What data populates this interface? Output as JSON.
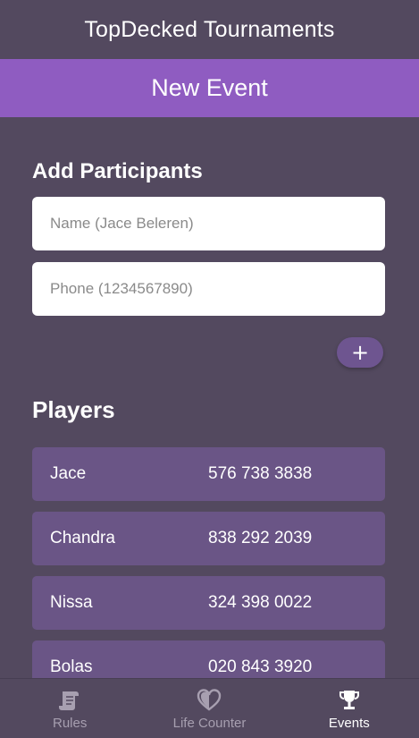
{
  "app": {
    "title": "TopDecked Tournaments"
  },
  "page": {
    "title": "New Event"
  },
  "add_participants": {
    "title": "Add Participants",
    "name_placeholder": "Name (Jace Beleren)",
    "phone_placeholder": "Phone (1234567890)",
    "add_button_label": "+"
  },
  "players": {
    "title": "Players",
    "rows": [
      {
        "name": "Jace",
        "phone": "576 738 3838"
      },
      {
        "name": "Chandra",
        "phone": "838 292 2039"
      },
      {
        "name": "Nissa",
        "phone": "324 398 0022"
      },
      {
        "name": "Bolas",
        "phone": "020 843 3920"
      }
    ]
  },
  "bottom_nav": {
    "items": [
      {
        "label": "Rules",
        "icon": "scroll-icon",
        "active": false
      },
      {
        "label": "Life Counter",
        "icon": "heart-icon",
        "active": false
      },
      {
        "label": "Events",
        "icon": "trophy-icon",
        "active": true
      }
    ]
  },
  "colors": {
    "background": "#53495f",
    "banner": "#8f5cc1",
    "player_row": "#6a5586",
    "add_button": "#6e5590"
  }
}
